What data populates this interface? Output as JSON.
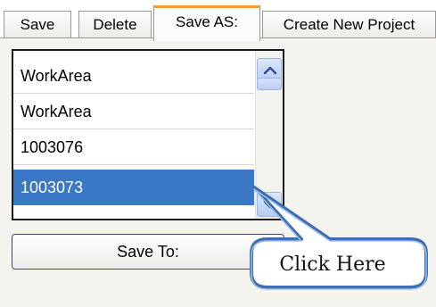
{
  "tabs": [
    {
      "label": "Save",
      "active": false
    },
    {
      "label": "Delete",
      "active": false
    },
    {
      "label": "Save AS:",
      "active": true
    },
    {
      "label": "Create New Project",
      "active": false
    }
  ],
  "listbox": {
    "items": [
      {
        "label": "WorkArea",
        "selected": false
      },
      {
        "label": "WorkArea",
        "selected": false
      },
      {
        "label": "1003076",
        "selected": false
      },
      {
        "label": "1003073",
        "selected": true
      }
    ]
  },
  "save_to_button": {
    "label": "Save To:"
  },
  "callout": {
    "text": "Click Here"
  },
  "colors": {
    "selection": "#3a78c5",
    "active_tab_accent": "#f0a030",
    "callout_border": "#3d6fb0"
  },
  "icons": {
    "scroll_up": "chevron-up-icon",
    "scroll_down": "chevron-down-icon"
  }
}
